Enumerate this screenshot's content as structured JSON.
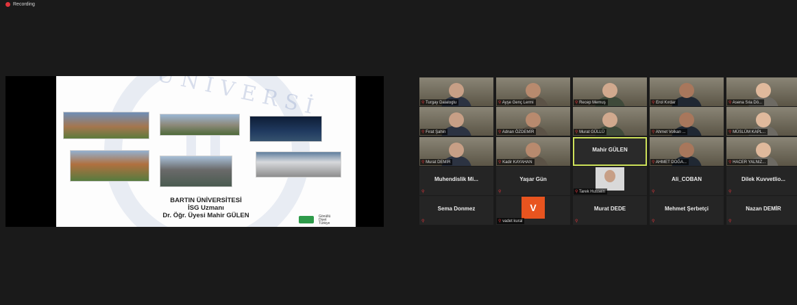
{
  "recording": {
    "label": "Recording"
  },
  "slide": {
    "watermark": "ÜNİVERSİ",
    "lines": [
      "BARTIN ÜNİVERSİTESİ",
      "İSG Uzmanı",
      "Dr. Öğr. Üyesi Mahir GÜLEN"
    ],
    "logo_text": "Gönüllü Diyet Türkiye"
  },
  "participants": [
    {
      "name": "Turgay Dalaloglu",
      "type": "video"
    },
    {
      "name": "Ayşe Genç Lermi",
      "type": "video"
    },
    {
      "name": "Recep Memuş",
      "type": "video"
    },
    {
      "name": "Erol Kırdar",
      "type": "video"
    },
    {
      "name": "Asena Sıla Dö...",
      "type": "video"
    },
    {
      "name": "Fırat Şahin",
      "type": "video"
    },
    {
      "name": "Adnan ÖZDEMİR",
      "type": "video"
    },
    {
      "name": "Murat GÜLLÜ",
      "type": "video"
    },
    {
      "name": "Ahmet Volkan ...",
      "type": "video"
    },
    {
      "name": "MÜSLÜM KAPL...",
      "type": "video"
    },
    {
      "name": "Murat DEMİR",
      "type": "video"
    },
    {
      "name": "Kadir KAYAHAN",
      "type": "video"
    },
    {
      "name": "Mahir GÜLEN",
      "type": "name",
      "active": true
    },
    {
      "name": "AHMET DOĞA...",
      "type": "video"
    },
    {
      "name": "HACER YALNIZ...",
      "type": "video"
    },
    {
      "name": "Muhendislik Mi...",
      "type": "name"
    },
    {
      "name": "Yaşar Gün",
      "type": "name"
    },
    {
      "name": "Tarek Hussein",
      "type": "photo"
    },
    {
      "name": "Ali_COBAN",
      "type": "name"
    },
    {
      "name": "Dilek Kuvvetlio...",
      "type": "name"
    },
    {
      "name": "Sema Donmez",
      "type": "name"
    },
    {
      "name": "vadet kural",
      "type": "avatar",
      "initial": "V"
    },
    {
      "name": "Murat DEDE",
      "type": "name"
    },
    {
      "name": "Mehmet Şerbetçi",
      "type": "name"
    },
    {
      "name": "Nazan DEMİR",
      "type": "name"
    }
  ]
}
